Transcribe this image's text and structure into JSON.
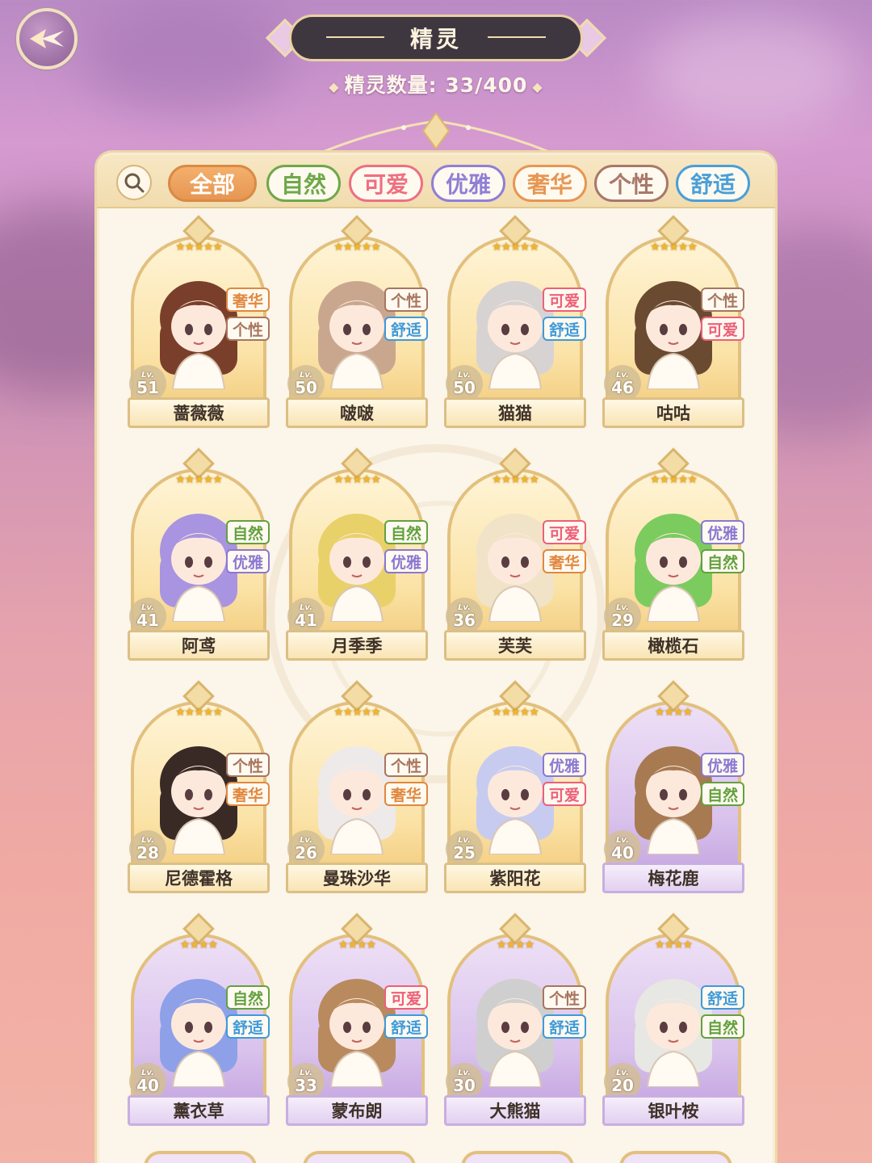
{
  "header": {
    "back_icon": "back-arrow-icon",
    "title": "精灵",
    "count_label": "精灵数量:",
    "count_value": "33/400"
  },
  "filters": {
    "search_icon": "search-icon",
    "tabs": [
      {
        "label": "全部",
        "color": "#e79653",
        "active": true
      },
      {
        "label": "自然",
        "color": "#6fa84a"
      },
      {
        "label": "可爱",
        "color": "#ee6f82"
      },
      {
        "label": "优雅",
        "color": "#8f7fd6"
      },
      {
        "label": "奢华",
        "color": "#e79653"
      },
      {
        "label": "个性",
        "color": "#a9786a"
      },
      {
        "label": "舒适",
        "color": "#4a9fd8"
      }
    ]
  },
  "tag_colors": {
    "奢华": "#e0883f",
    "个性": "#a8765f",
    "舒适": "#3f9ad8",
    "可爱": "#ee5f78",
    "自然": "#63a13e",
    "优雅": "#8a78d2"
  },
  "cards": [
    {
      "name": "蔷薇薇",
      "level": "51",
      "stars": 5,
      "tags": [
        "奢华",
        "个性"
      ],
      "lv_label": "Lv."
    },
    {
      "name": "啵啵",
      "level": "50",
      "stars": 5,
      "tags": [
        "个性",
        "舒适"
      ],
      "lv_label": "Lv."
    },
    {
      "name": "猫猫",
      "level": "50",
      "stars": 5,
      "tags": [
        "可爱",
        "舒适"
      ],
      "lv_label": "Lv."
    },
    {
      "name": "咕咕",
      "level": "46",
      "stars": 5,
      "tags": [
        "个性",
        "可爱"
      ],
      "lv_label": "Lv."
    },
    {
      "name": "阿鸢",
      "level": "41",
      "stars": 5,
      "tags": [
        "自然",
        "优雅"
      ],
      "lv_label": "Lv."
    },
    {
      "name": "月季季",
      "level": "41",
      "stars": 5,
      "tags": [
        "自然",
        "优雅"
      ],
      "lv_label": "Lv."
    },
    {
      "name": "芙芙",
      "level": "36",
      "stars": 5,
      "tags": [
        "可爱",
        "奢华"
      ],
      "lv_label": "Lv."
    },
    {
      "name": "橄榄石",
      "level": "29",
      "stars": 5,
      "tags": [
        "优雅",
        "自然"
      ],
      "lv_label": "Lv."
    },
    {
      "name": "尼德霍格",
      "level": "28",
      "stars": 5,
      "tags": [
        "个性",
        "奢华"
      ],
      "lv_label": "Lv."
    },
    {
      "name": "曼珠沙华",
      "level": "26",
      "stars": 5,
      "tags": [
        "个性",
        "奢华"
      ],
      "lv_label": "Lv."
    },
    {
      "name": "紫阳花",
      "level": "25",
      "stars": 5,
      "tags": [
        "优雅",
        "可爱"
      ],
      "lv_label": "Lv."
    },
    {
      "name": "梅花鹿",
      "level": "40",
      "stars": 4,
      "tags": [
        "优雅",
        "自然"
      ],
      "lv_label": "Lv."
    },
    {
      "name": "薰衣草",
      "level": "40",
      "stars": 4,
      "tags": [
        "自然",
        "舒适"
      ],
      "lv_label": "Lv."
    },
    {
      "name": "蒙布朗",
      "level": "33",
      "stars": 4,
      "tags": [
        "可爱",
        "舒适"
      ],
      "lv_label": "Lv."
    },
    {
      "name": "大熊猫",
      "level": "30",
      "stars": 4,
      "tags": [
        "个性",
        "舒适"
      ],
      "lv_label": "Lv."
    },
    {
      "name": "银叶桉",
      "level": "20",
      "stars": 4,
      "tags": [
        "舒适",
        "自然"
      ],
      "lv_label": "Lv."
    }
  ]
}
